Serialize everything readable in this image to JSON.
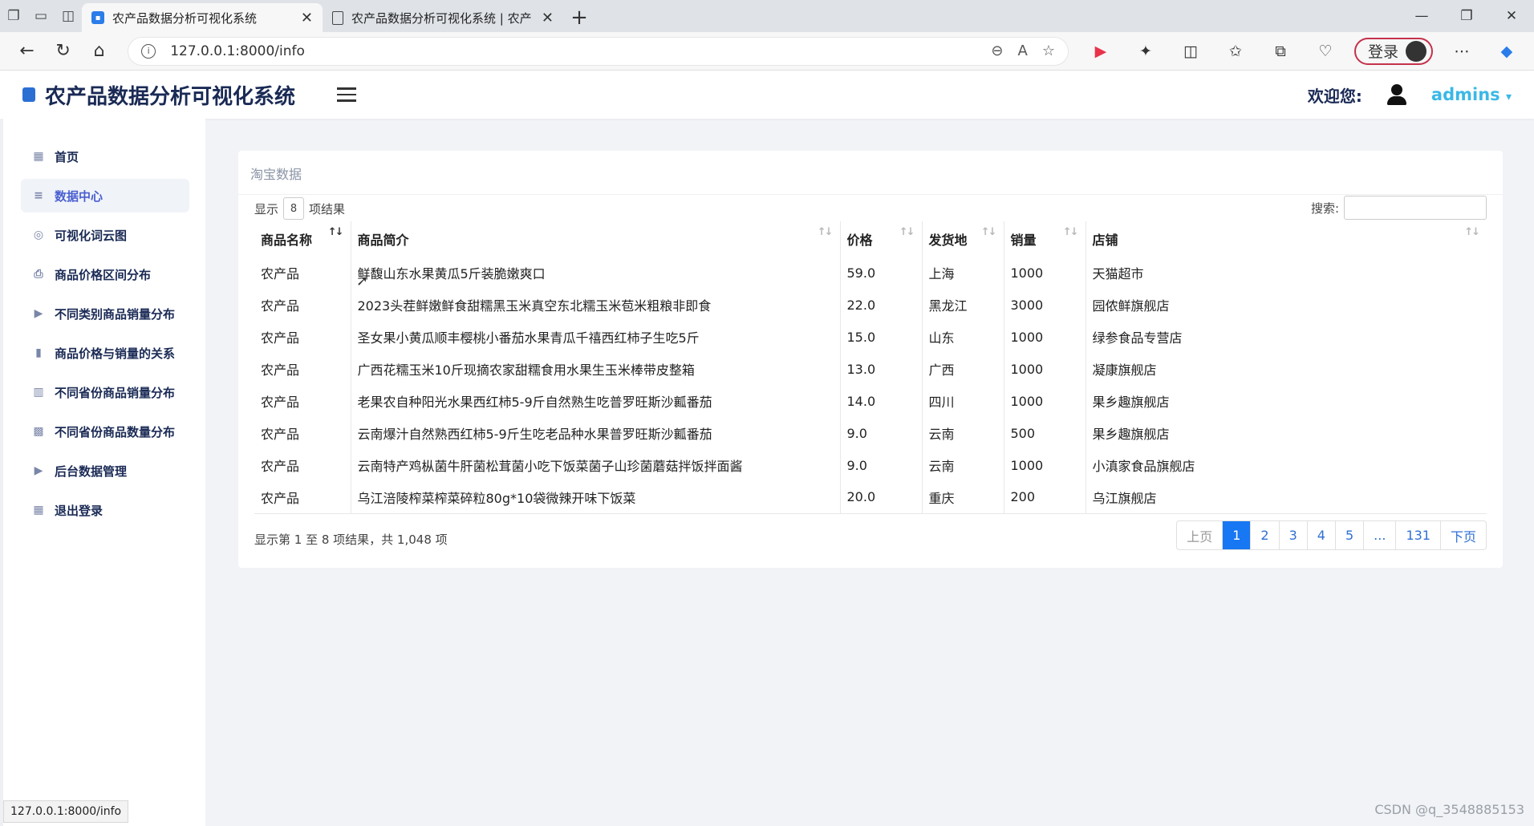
{
  "browser": {
    "tabs": [
      {
        "title": "农产品数据分析可视化系统",
        "active": true
      },
      {
        "title": "农产品数据分析可视化系统 | 农产",
        "active": false
      }
    ],
    "url": "127.0.0.1:8000/info",
    "login_label": "登录",
    "status_url": "127.0.0.1:8000/info"
  },
  "app": {
    "title": "农产品数据分析可视化系统",
    "welcome": "欢迎您:",
    "username": "admins",
    "username_caret": "▾"
  },
  "sidebar": {
    "items": [
      {
        "label": "首页",
        "icon": "grid-icon",
        "glyph": "▦",
        "active": false
      },
      {
        "label": "数据中心",
        "icon": "database-icon",
        "glyph": "≡",
        "active": true
      },
      {
        "label": "可视化词云图",
        "icon": "wordpress-icon",
        "glyph": "◎",
        "active": false
      },
      {
        "label": "商品价格区间分布",
        "icon": "printer-icon",
        "glyph": "⎙",
        "active": false
      },
      {
        "label": "不同类别商品销量分布",
        "icon": "play-icon",
        "glyph": "▶",
        "active": false
      },
      {
        "label": "商品价格与销量的关系",
        "icon": "bar-chart-icon",
        "glyph": "▮",
        "active": false
      },
      {
        "label": "不同省份商品销量分布",
        "icon": "map-icon",
        "glyph": "▥",
        "active": false
      },
      {
        "label": "不同省份商品数量分布",
        "icon": "map-filled-icon",
        "glyph": "▩",
        "active": false
      },
      {
        "label": "后台数据管理",
        "icon": "play-icon",
        "glyph": "▶",
        "active": false
      },
      {
        "label": "退出登录",
        "icon": "grid-icon",
        "glyph": "▦",
        "active": false
      }
    ]
  },
  "card": {
    "title": "淘宝数据",
    "length_prefix": "显示",
    "length_value": "8",
    "length_suffix": "项结果",
    "search_label": "搜索:",
    "search_value": "",
    "columns": [
      "商品名称",
      "商品简介",
      "价格",
      "发货地",
      "销量",
      "店铺"
    ],
    "rows": [
      [
        "农产品",
        "鲜馥山东水果黄瓜5斤装脆嫩爽口",
        "59.0",
        "上海",
        "1000",
        "天猫超市"
      ],
      [
        "农产品",
        "2023头茬鲜嫩鲜食甜糯黑玉米真空东北糯玉米苞米粗粮非即食",
        "22.0",
        "黑龙江",
        "3000",
        "园侬鲜旗舰店"
      ],
      [
        "农产品",
        "圣女果小黄瓜顺丰樱桃小番茄水果青瓜千禧西红柿子生吃5斤",
        "15.0",
        "山东",
        "1000",
        "绿参食品专营店"
      ],
      [
        "农产品",
        "广西花糯玉米10斤现摘农家甜糯食用水果生玉米棒带皮整箱",
        "13.0",
        "广西",
        "1000",
        "凝康旗舰店"
      ],
      [
        "农产品",
        "老果农自种阳光水果西红柿5-9斤自然熟生吃普罗旺斯沙瓤番茄",
        "14.0",
        "四川",
        "1000",
        "果乡趣旗舰店"
      ],
      [
        "农产品",
        "云南爆汁自然熟西红柿5-9斤生吃老品种水果普罗旺斯沙瓤番茄",
        "9.0",
        "云南",
        "500",
        "果乡趣旗舰店"
      ],
      [
        "农产品",
        "云南特产鸡枞菌牛肝菌松茸菌小吃下饭菜菌子山珍菌蘑菇拌饭拌面酱",
        "9.0",
        "云南",
        "1000",
        "小滇家食品旗舰店"
      ],
      [
        "农产品",
        "乌江涪陵榨菜榨菜碎粒80g*10袋微辣开味下饭菜",
        "20.0",
        "重庆",
        "200",
        "乌江旗舰店"
      ]
    ],
    "info": "显示第 1 至 8 项结果，共 1,048 项",
    "pager": [
      "上页",
      "1",
      "2",
      "3",
      "4",
      "5",
      "...",
      "131",
      "下页"
    ],
    "current_page": "1"
  },
  "watermark": "CSDN @q_3548885153"
}
